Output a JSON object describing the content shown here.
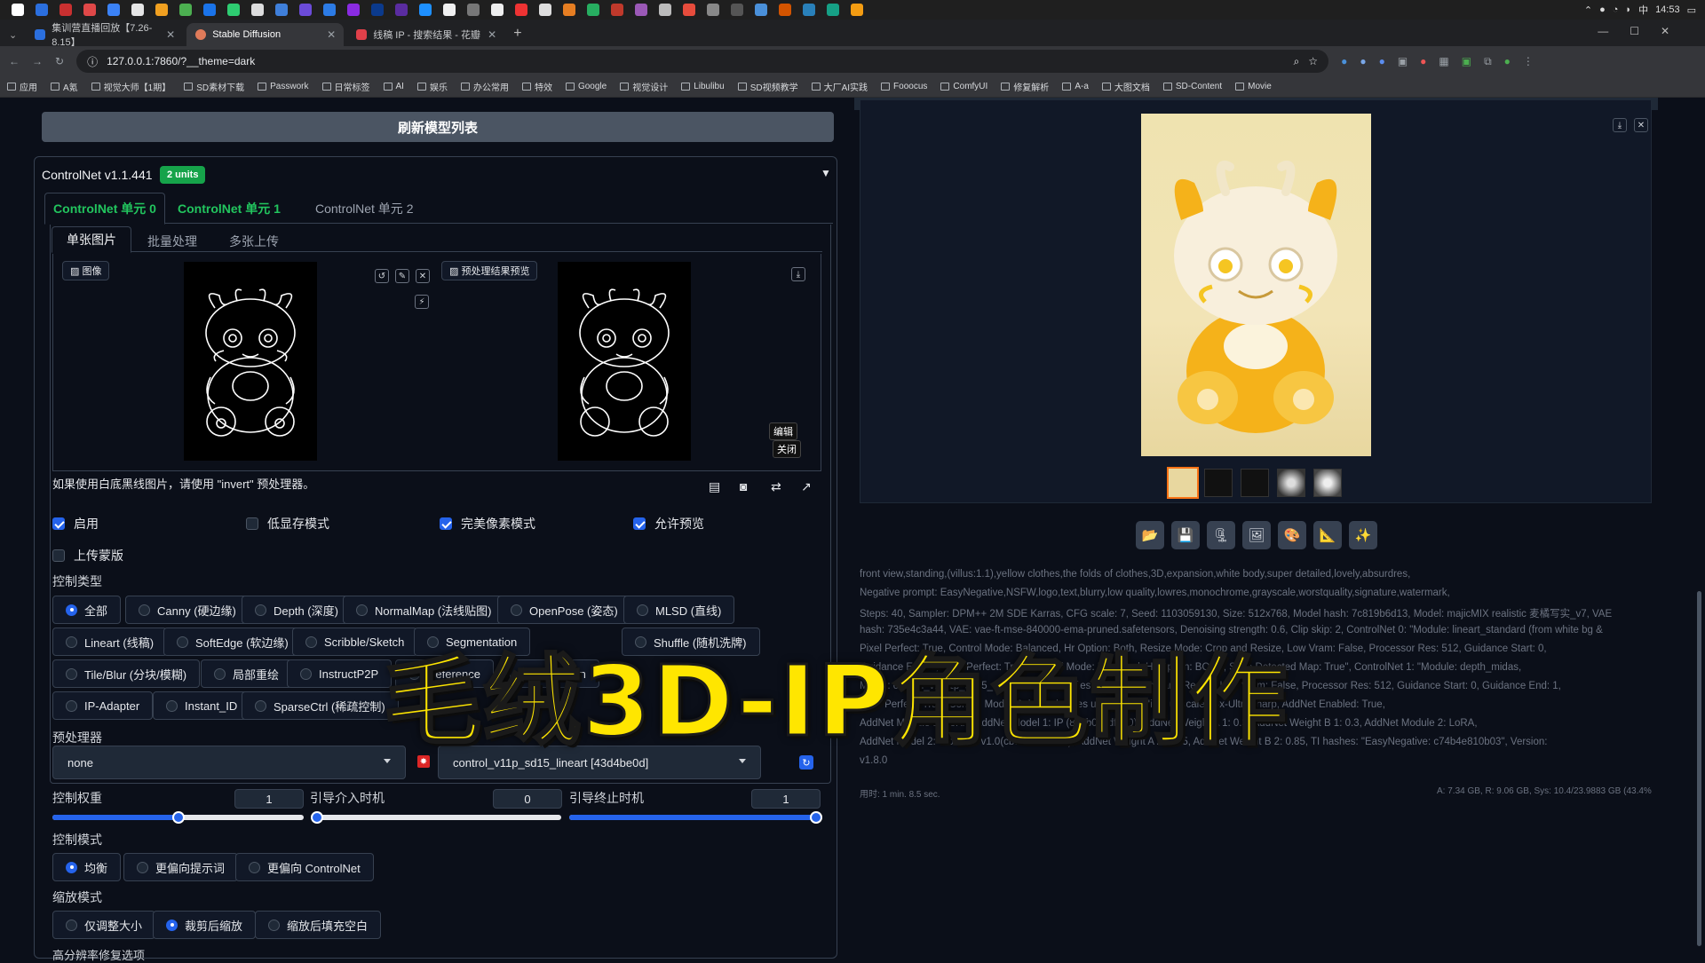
{
  "taskbar": {
    "time": "14:53",
    "ime": "中"
  },
  "tabs": [
    {
      "label": "集训营直播回放【7.26-8.15】",
      "color": "#2b6fde"
    },
    {
      "label": "Stable Diffusion",
      "color": "#e07b5a"
    },
    {
      "label": "线稿 IP - 搜索结果 - 花瓣",
      "color": "#e0404a"
    }
  ],
  "address": {
    "url": "127.0.0.1:7860/?__theme=dark"
  },
  "bookmarks": [
    "应用",
    "A氪",
    "视觉大师【1期】",
    "SD素材下载",
    "Passwork",
    "日常标签",
    "AI",
    "娱乐",
    "办公常用",
    "特效",
    "Google",
    "视觉设计",
    "Libulibu",
    "SD视频教学",
    "大厂AI实践",
    "Fooocus",
    "ComfyUI",
    "修复解析",
    "A-a",
    "大图文档",
    "SD-Content",
    "Movie"
  ],
  "left": {
    "refresh_label": "刷新模型列表",
    "controlnet": {
      "title": "ControlNet v1.1.441",
      "units_badge": "2 units",
      "unit_tabs": [
        "ControlNet 单元 0",
        "ControlNet 单元 1",
        "ControlNet 单元 2"
      ],
      "sub_tabs": [
        "单张图片",
        "批量处理",
        "多张上传"
      ],
      "image_label": "图像",
      "preview_label": "预处理结果预览",
      "edit_label": "编辑",
      "close_label": "关闭",
      "hint": "如果使用白底黑线图片，请使用 \"invert\" 预处理器。",
      "checks": [
        {
          "label": "启用",
          "checked": true
        },
        {
          "label": "低显存模式",
          "checked": false
        },
        {
          "label": "完美像素模式",
          "checked": true
        },
        {
          "label": "允许预览",
          "checked": true
        },
        {
          "label": "上传蒙版",
          "checked": false
        }
      ],
      "control_type_label": "控制类型",
      "control_types": [
        "全部",
        "Canny (硬边缘)",
        "Depth (深度)",
        "NormalMap (法线贴图)",
        "OpenPose (姿态)",
        "MLSD (直线)",
        "Lineart (线稿)",
        "SoftEdge (软边缘)",
        "Scribble/Sketch",
        "Segmentation",
        "Shuffle (随机洗牌)",
        "Tile/Blur (分块/模糊)",
        "局部重绘",
        "InstructP2P",
        "Reference",
        "Revision",
        "IP-Adapter",
        "Instant_ID",
        "SparseCtrl (稀疏控制)"
      ],
      "preprocessor_label": "预处理器",
      "preprocessor_value": "none",
      "model_label": "模型",
      "model_value": "control_v11p_sd15_lineart [43d4be0d]",
      "weight_label": "控制权重",
      "weight_value": "1",
      "start_label": "引导介入时机",
      "start_value": "0",
      "end_label": "引导终止时机",
      "end_value": "1",
      "weight_fraction": 0.5,
      "start_fraction": 0.0,
      "end_fraction": 1.0,
      "mode_label": "控制模式",
      "modes": [
        "均衡",
        "更偏向提示词",
        "更偏向 ControlNet"
      ],
      "resize_label": "缩放模式",
      "resizes": [
        "仅调整大小",
        "裁剪后缩放",
        "缩放后填充空白"
      ],
      "hires_label": "高分辨率修复选项"
    }
  },
  "right": {
    "tool_icons": [
      "folder-icon",
      "save-icon",
      "zip-icon",
      "image-icon",
      "palette-icon",
      "ruler-icon",
      "sparkle-icon"
    ],
    "info_lines": [
      "front view,standing,(villus:1.1),yellow clothes,the folds of clothes,3D,expansion,white body,super detailed,lovely,absurdres,",
      "Negative prompt: EasyNegative,NSFW,logo,text,blurry,low quality,lowres,monochrome,grayscale,worstquality,signature,watermark,",
      "Steps: 40, Sampler: DPM++ 2M SDE Karras, CFG scale: 7, Seed: 1103059130, Size: 512x768, Model hash: 7c819b6d13, Model: majicMIX realistic 麦橘写实_v7, VAE",
      "hash: 735e4c3a44, VAE: vae-ft-mse-840000-ema-pruned.safetensors, Denoising strength: 0.6, Clip skip: 2, ControlNet 0: \"Module: lineart_standard (from white bg &",
      "Pixel Perfect: True, Control Mode: Balanced, Hr Option: Both, Resize Mode: Crop and Resize, Low Vram: False, Processor Res: 512, Guidance Start: 0,",
      "Guidance End: 1, Pixel Perfect: True, Control Mode: Balanced, Hr Option: BOTH, Save Detected Map: True\", ControlNet 1: \"Module: depth_midas,",
      "Model: control_v11f1p_sd15_depth, Weight: 1, Resize Mode: Crop and Resize, Low Vram: False, Processor Res: 512, Guidance Start: 0, Guidance End: 1,",
      "Pixel Perfect: True, Control Mode: Balanced, Hires upscale: 2, Hires upscaler: 4x-UltraSharp, AddNet Enabled: True,",
      "AddNet Module 1: LoRA, AddNet Model 1: IP (8c3b03cdfa40), AddNet Weight A 1: 0.3, AddNet Weight B 1: 0.3, AddNet Module 2: LoRA,",
      "AddNet Model 2: Wool felt v1.0(cb910e2e047f), AddNet Weight A 2: 0.85, AddNet Weight B 2: 0.85, TI hashes: \"EasyNegative: c74b4e810b03\", Version:",
      "v1.8.0"
    ],
    "time_taken": "用时: 1 min. 8.5 sec.",
    "vram": "A: 7.34 GB, R: 9.06 GB, Sys: 10.4/23.9883 GB (43.4%)"
  },
  "overlay_title": "毛绒3D-IP角色制作",
  "colors": {
    "accent": "#2563eb",
    "badge": "#16a34a",
    "tab_active": "#22c55e",
    "overlay": "#ffe600"
  }
}
